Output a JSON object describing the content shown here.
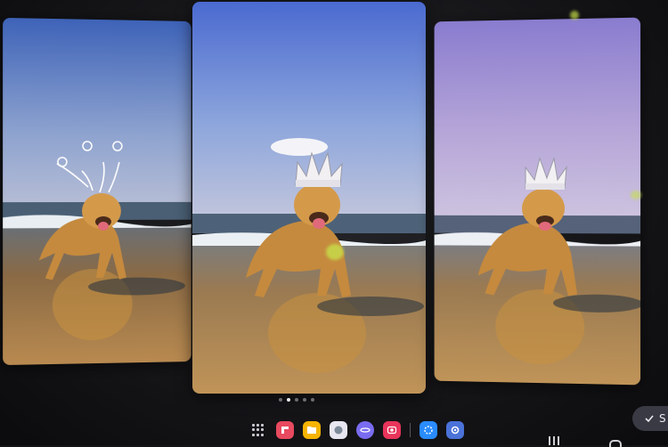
{
  "gallery": {
    "cards": [
      {
        "name": "sketched-crown-version"
      },
      {
        "name": "generated-crown-version"
      },
      {
        "name": "generated-crown-alt-version"
      }
    ],
    "page_count": 5,
    "active_page": 2
  },
  "dock": {
    "apps": [
      {
        "name": "app-grid-icon",
        "color": "#c9c9cf"
      },
      {
        "name": "flipboard-app-icon",
        "color": "#e84a5f"
      },
      {
        "name": "files-app-icon",
        "color": "#f5b400"
      },
      {
        "name": "messages-app-icon",
        "color": "#e8e6f0"
      },
      {
        "name": "internet-app-icon",
        "color": "#7a6cf0"
      },
      {
        "name": "camera-app-icon",
        "color": "#e8345a"
      },
      {
        "name": "bixby-app-icon",
        "color": "#2a8cff"
      },
      {
        "name": "settings-app-icon",
        "color": "#4a72d8"
      }
    ]
  },
  "done_button": {
    "label": "S"
  },
  "colors": {
    "accent": "#3a3a44",
    "background": "#141416"
  }
}
